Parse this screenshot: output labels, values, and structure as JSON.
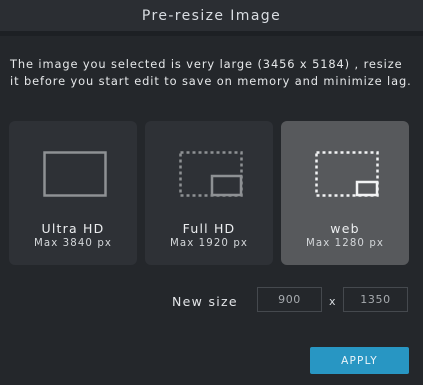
{
  "dialog": {
    "title": "Pre-resize Image",
    "message": "The image you selected is very large (3456 x 5184) , resize it before you start edit to save on memory and minimize lag."
  },
  "options": [
    {
      "name": "Ultra HD",
      "sub": "Max 3840 px",
      "icon": "ultra-hd-icon",
      "selected": false
    },
    {
      "name": "Full HD",
      "sub": "Max 1920 px",
      "icon": "full-hd-icon",
      "selected": false
    },
    {
      "name": "web",
      "sub": "Max 1280 px",
      "icon": "web-size-icon",
      "selected": true
    }
  ],
  "new_size": {
    "label": "New size",
    "width": "900",
    "separator": "x",
    "height": "1350"
  },
  "apply_label": "APPLY",
  "colors": {
    "background": "#24272b",
    "card": "#2e3136",
    "card_selected": "#57595c",
    "accent": "#2896c3"
  }
}
